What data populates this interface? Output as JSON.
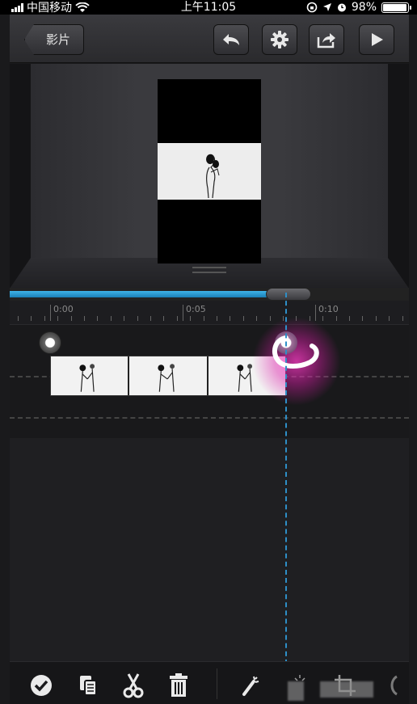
{
  "status_bar": {
    "carrier": "中国移动",
    "time": "上午11:05",
    "battery": "98%",
    "battery_level": 0.98
  },
  "topbar": {
    "back_label": "影片",
    "buttons": [
      "undo-icon",
      "gear-icon",
      "share-icon",
      "play-icon"
    ]
  },
  "playback": {
    "progress": 0.65
  },
  "timeline": {
    "ticks": [
      "0:00",
      "0:05",
      "0:10"
    ]
  },
  "colors": {
    "accent": "#2e9bd6",
    "glow": "#ff33c8"
  },
  "toolbar": {
    "tools": [
      "check-icon",
      "copy-clip-icon",
      "scissors-icon",
      "trash-icon",
      "magic-wand-icon",
      "brightness-icon",
      "crop-icon",
      "more-icon"
    ]
  }
}
